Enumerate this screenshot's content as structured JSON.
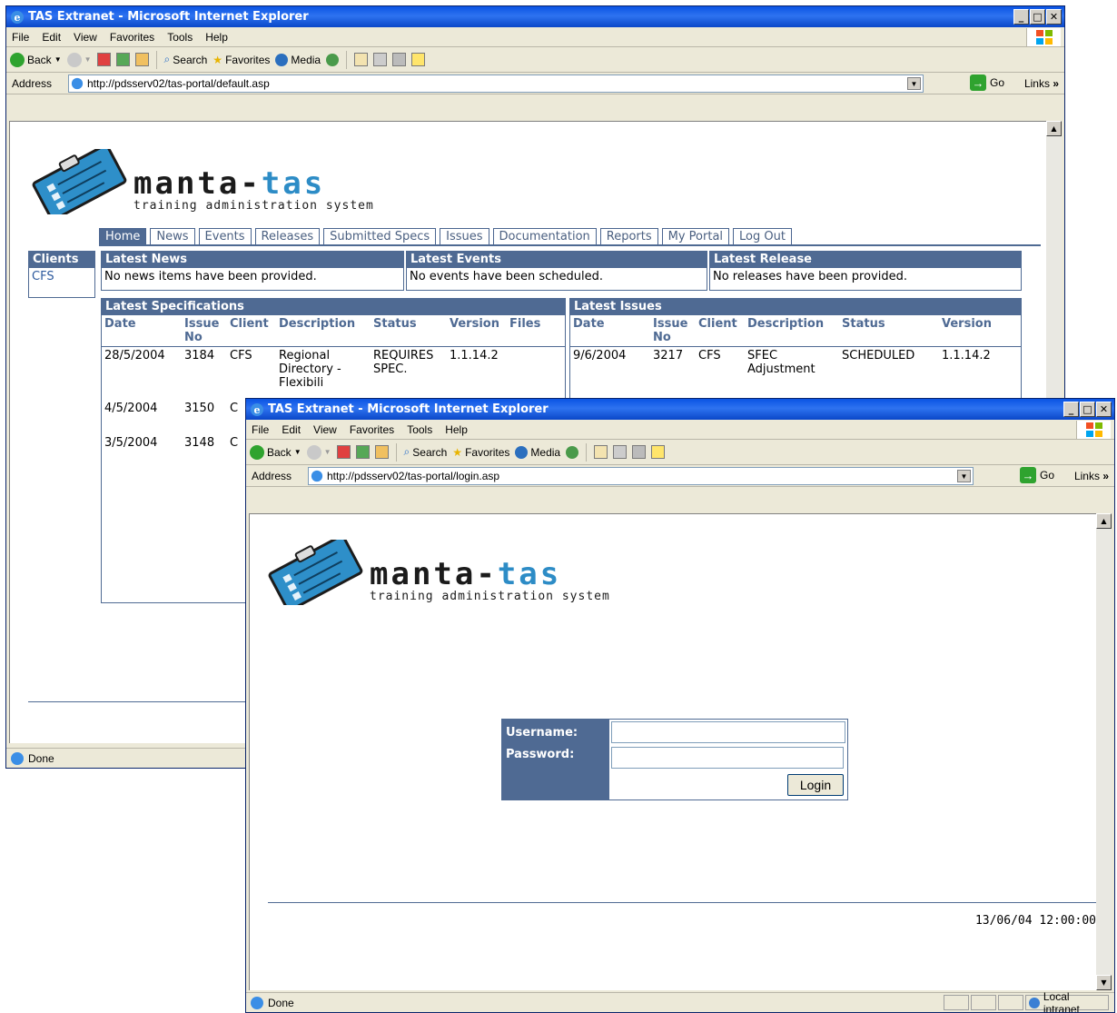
{
  "win1": {
    "title": "TAS Extranet - Microsoft Internet Explorer",
    "menu": [
      "File",
      "Edit",
      "View",
      "Favorites",
      "Tools",
      "Help"
    ],
    "toolbar": {
      "back": "Back",
      "search": "Search",
      "favorites": "Favorites",
      "media": "Media"
    },
    "address_label": "Address",
    "url": "http://pdsserv02/tas-portal/default.asp",
    "go": "Go",
    "links": "Links",
    "status": "Done",
    "logo": {
      "title_a": "manta-",
      "title_b": "tas",
      "subtitle": "training administration system"
    },
    "nav": [
      "Home",
      "News",
      "Events",
      "Releases",
      "Submitted Specs",
      "Issues",
      "Documentation",
      "Reports",
      "My Portal",
      "Log Out"
    ],
    "clients": {
      "header": "Clients",
      "items": [
        "CFS"
      ]
    },
    "news": {
      "header": "Latest News",
      "text": "No news items have been provided."
    },
    "events": {
      "header": "Latest Events",
      "text": "No events have been scheduled."
    },
    "release": {
      "header": "Latest Release",
      "text": "No releases have been provided."
    },
    "specs": {
      "header": "Latest Specifications",
      "columns": [
        "Date",
        "Issue No",
        "Client",
        "Description",
        "Status",
        "Version",
        "Files"
      ],
      "rows": [
        {
          "date": "28/5/2004",
          "issue": "3184",
          "client": "CFS",
          "desc": "Regional Directory - Flexibili",
          "status": "REQUIRES SPEC.",
          "version": "1.1.14.2"
        },
        {
          "date": "4/5/2004",
          "issue": "3150",
          "client": "C",
          "desc": "",
          "status": "",
          "version": ""
        },
        {
          "date": "3/5/2004",
          "issue": "3148",
          "client": "C",
          "desc": "",
          "status": "",
          "version": ""
        }
      ]
    },
    "issues": {
      "header": "Latest Issues",
      "columns": [
        "Date",
        "Issue No",
        "Client",
        "Description",
        "Status",
        "Version"
      ],
      "rows": [
        {
          "date": "9/6/2004",
          "issue": "3217",
          "client": "CFS",
          "desc": "SFEC Adjustment",
          "status": "SCHEDULED",
          "version": "1.1.14.2"
        }
      ]
    }
  },
  "win2": {
    "title": "TAS Extranet - Microsoft Internet Explorer",
    "menu": [
      "File",
      "Edit",
      "View",
      "Favorites",
      "Tools",
      "Help"
    ],
    "toolbar": {
      "back": "Back",
      "search": "Search",
      "favorites": "Favorites",
      "media": "Media"
    },
    "address_label": "Address",
    "url": "http://pdsserv02/tas-portal/login.asp",
    "go": "Go",
    "links": "Links",
    "status": "Done",
    "zone": "Local intranet",
    "logo": {
      "title_a": "manta-",
      "title_b": "tas",
      "subtitle": "training administration system"
    },
    "login": {
      "username_label": "Username:",
      "password_label": "Password:",
      "username": "",
      "password": "",
      "button": "Login"
    },
    "timestamp": "13/06/04 12:00:00"
  },
  "colors": {
    "brand": "#4f6a93",
    "accent": "#2d8cc6",
    "titlebar": "#0a54e3"
  }
}
